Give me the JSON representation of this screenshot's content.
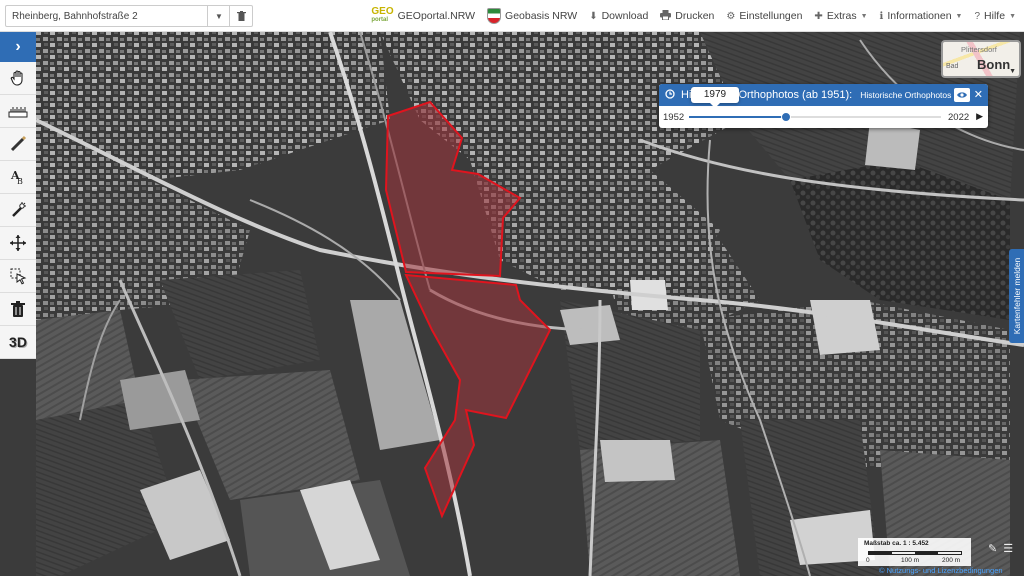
{
  "search": {
    "value": "Rheinberg, Bahnhofstraße 2",
    "dropdown_icon": "caret-down-icon",
    "clear_icon": "trash-icon"
  },
  "nav": {
    "geoportal_logo_top": "GEO",
    "geoportal_logo_bottom": "portal",
    "geoportal": "GEOportal.NRW",
    "geobasis": "Geobasis NRW",
    "download": "Download",
    "print": "Drucken",
    "settings": "Einstellungen",
    "extras": "Extras",
    "info": "Informationen",
    "help": "Hilfe"
  },
  "toolbar": {
    "items": [
      "pan-hand-icon",
      "measure-ruler-icon",
      "draw-line-icon",
      "text-label-icon",
      "magic-wand-icon",
      "move-arrows-icon",
      "select-pointer-icon",
      "trash-icon",
      "3d-view-icon"
    ],
    "label_3d": "3D"
  },
  "ortho": {
    "title": "Historische Orthophotos (ab 1951):",
    "subtitle": "Historische Orthophotos",
    "year_start": "1952",
    "year_end": "2022",
    "selected_year": "1979",
    "slider_fraction": 0.385
  },
  "basemap": {
    "label_top": "Plittersdorf",
    "label_bad": "Bad",
    "label_city": "Bonn"
  },
  "report_tab": "Kartenfehler melden",
  "scale": {
    "label": "Maßstab ca. 1 : 5.452",
    "ticks": [
      "0",
      "100 m",
      "200 m"
    ]
  },
  "license": "© Nutzungs- und Lizenzbedingungen",
  "colors": {
    "accent": "#2f6db5",
    "highlight_stroke": "#e0141e",
    "highlight_fill": "#a0353d"
  }
}
